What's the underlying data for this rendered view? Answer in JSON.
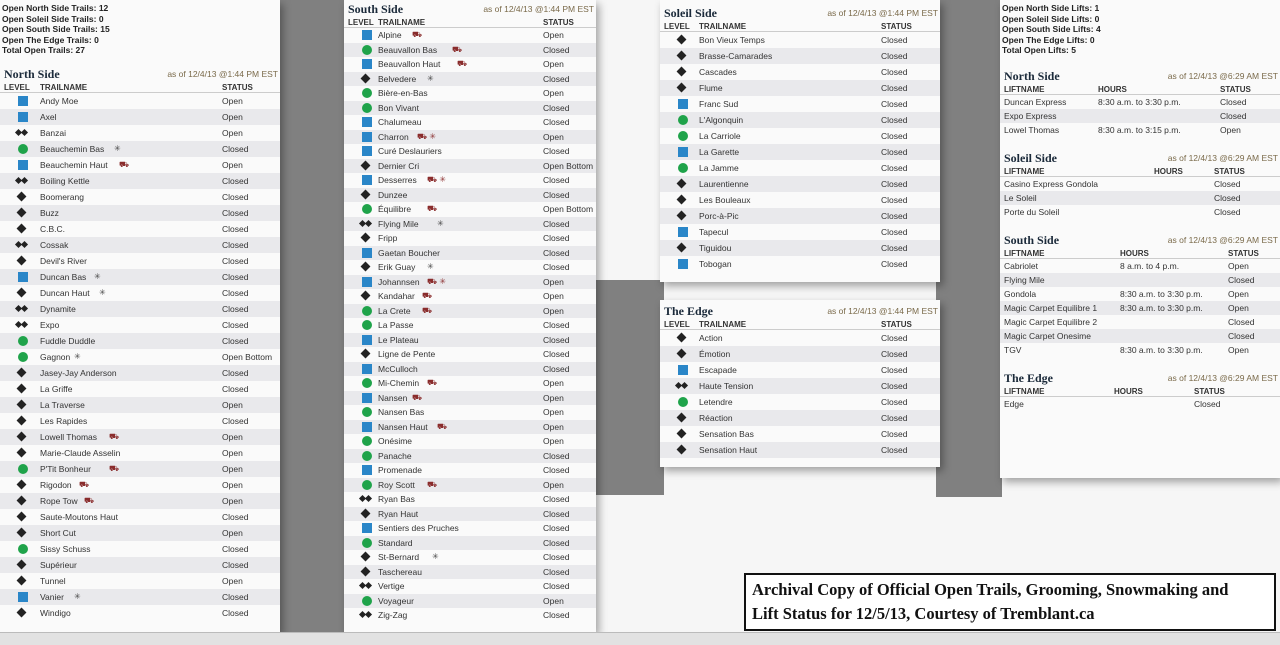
{
  "trail_summary": [
    "Open North Side Trails: 12",
    "Open Soleil Side Trails: 0",
    "Open South Side Trails: 15",
    "Open The Edge Trails: 0",
    "Total Open Trails: 27"
  ],
  "lift_summary": [
    "Open North Side Lifts: 1",
    "Open Soleil Side Lifts: 0",
    "Open South Side Lifts: 4",
    "Open The Edge Lifts: 0",
    "Total Open Lifts: 5"
  ],
  "trail_cols": {
    "level": "LEVEL",
    "name": "TRAILNAME",
    "status": "STATUS"
  },
  "lift_cols": {
    "name": "LIFTNAME",
    "hours": "HOURS",
    "status": "STATUS"
  },
  "north": {
    "title": "North Side",
    "asof": "as of 12/4/13 @1:44 PM EST",
    "trails": [
      {
        "l": "square",
        "n": "Andy Moe",
        "m": "",
        "s": "Open"
      },
      {
        "l": "square",
        "n": "Axel",
        "m": "",
        "s": "Open"
      },
      {
        "l": "double",
        "n": "Banzai",
        "m": "",
        "s": "Open"
      },
      {
        "l": "circle",
        "n": "Beauchemin Bas",
        "m": "✳",
        "s": "Closed"
      },
      {
        "l": "square",
        "n": "Beauchemin Haut",
        "m": "⛟",
        "s": "Open"
      },
      {
        "l": "double",
        "n": "Boiling Kettle",
        "m": "",
        "s": "Closed"
      },
      {
        "l": "diamond",
        "n": "Boomerang",
        "m": "",
        "s": "Closed"
      },
      {
        "l": "diamond",
        "n": "Buzz",
        "m": "",
        "s": "Closed"
      },
      {
        "l": "diamond",
        "n": "C.B.C.",
        "m": "",
        "s": "Closed"
      },
      {
        "l": "double",
        "n": "Cossak",
        "m": "",
        "s": "Closed"
      },
      {
        "l": "diamond",
        "n": "Devil's River",
        "m": "",
        "s": "Closed"
      },
      {
        "l": "square",
        "n": "Duncan Bas",
        "m": "✳",
        "s": "Closed"
      },
      {
        "l": "diamond",
        "n": "Duncan Haut",
        "m": "✳",
        "s": "Closed"
      },
      {
        "l": "double",
        "n": "Dynamite",
        "m": "",
        "s": "Closed"
      },
      {
        "l": "double",
        "n": "Expo",
        "m": "",
        "s": "Closed"
      },
      {
        "l": "circle",
        "n": "Fuddle Duddle",
        "m": "",
        "s": "Closed"
      },
      {
        "l": "circle",
        "n": "Gagnon",
        "m": "✳",
        "s": "Open Bottom"
      },
      {
        "l": "diamond",
        "n": "Jasey-Jay Anderson",
        "m": "",
        "s": "Closed"
      },
      {
        "l": "diamond",
        "n": "La Griffe",
        "m": "",
        "s": "Closed"
      },
      {
        "l": "diamond",
        "n": "La Traverse",
        "m": "",
        "s": "Open"
      },
      {
        "l": "diamond",
        "n": "Les Rapides",
        "m": "",
        "s": "Closed"
      },
      {
        "l": "diamond",
        "n": "Lowell Thomas",
        "m": "⛟",
        "s": "Open"
      },
      {
        "l": "diamond",
        "n": "Marie-Claude Asselin",
        "m": "",
        "s": "Open"
      },
      {
        "l": "circle",
        "n": "P'Tit Bonheur",
        "m": "⛟",
        "s": "Open"
      },
      {
        "l": "diamond",
        "n": "Rigodon",
        "m": "⛟",
        "s": "Open"
      },
      {
        "l": "diamond",
        "n": "Rope Tow",
        "m": "⛟",
        "s": "Open"
      },
      {
        "l": "diamond",
        "n": "Saute-Moutons Haut",
        "m": "",
        "s": "Closed"
      },
      {
        "l": "diamond",
        "n": "Short Cut",
        "m": "",
        "s": "Open"
      },
      {
        "l": "circle",
        "n": "Sissy Schuss",
        "m": "",
        "s": "Closed"
      },
      {
        "l": "diamond",
        "n": "Supérieur",
        "m": "",
        "s": "Closed"
      },
      {
        "l": "diamond",
        "n": "Tunnel",
        "m": "",
        "s": "Open"
      },
      {
        "l": "square",
        "n": "Vanier",
        "m": "✳",
        "s": "Closed"
      },
      {
        "l": "diamond",
        "n": "Windigo",
        "m": "",
        "s": "Closed"
      }
    ]
  },
  "south": {
    "title": "South Side",
    "asof": "as of 12/4/13 @1:44 PM EST",
    "trails": [
      {
        "l": "square",
        "n": "Alpine",
        "m": "⛟",
        "s": "Open"
      },
      {
        "l": "circle",
        "n": "Beauvallon Bas",
        "m": "⛟",
        "s": "Closed"
      },
      {
        "l": "square",
        "n": "Beauvallon Haut",
        "m": "⛟",
        "s": "Open"
      },
      {
        "l": "diamond",
        "n": "Belvedere",
        "m": "✳",
        "s": "Closed"
      },
      {
        "l": "circle",
        "n": "Bière-en-Bas",
        "m": "",
        "s": "Open"
      },
      {
        "l": "circle",
        "n": "Bon Vivant",
        "m": "",
        "s": "Closed"
      },
      {
        "l": "square",
        "n": "Chalumeau",
        "m": "",
        "s": "Closed"
      },
      {
        "l": "square",
        "n": "Charron",
        "m": "⛟ ✳",
        "s": "Open"
      },
      {
        "l": "square",
        "n": "Curé Deslauriers",
        "m": "",
        "s": "Closed"
      },
      {
        "l": "diamond",
        "n": "Dernier Cri",
        "m": "",
        "s": "Open Bottom"
      },
      {
        "l": "square",
        "n": "Desserres",
        "m": "⛟ ✳",
        "s": "Closed"
      },
      {
        "l": "diamond",
        "n": "Dunzee",
        "m": "",
        "s": "Closed"
      },
      {
        "l": "circle",
        "n": "Équilibre",
        "m": "⛟",
        "s": "Open Bottom"
      },
      {
        "l": "double",
        "n": "Flying Mile",
        "m": "✳",
        "s": "Closed"
      },
      {
        "l": "diamond",
        "n": "Fripp",
        "m": "",
        "s": "Closed"
      },
      {
        "l": "square",
        "n": "Gaetan Boucher",
        "m": "",
        "s": "Closed"
      },
      {
        "l": "diamond",
        "n": "Erik Guay",
        "m": "✳",
        "s": "Closed"
      },
      {
        "l": "square",
        "n": "Johannsen",
        "m": "⛟ ✳",
        "s": "Open"
      },
      {
        "l": "diamond",
        "n": "Kandahar",
        "m": "⛟",
        "s": "Open"
      },
      {
        "l": "circle",
        "n": "La Crete",
        "m": "⛟",
        "s": "Open"
      },
      {
        "l": "circle",
        "n": "La Passe",
        "m": "",
        "s": "Closed"
      },
      {
        "l": "square",
        "n": "Le Plateau",
        "m": "",
        "s": "Closed"
      },
      {
        "l": "diamond",
        "n": "Ligne de Pente",
        "m": "",
        "s": "Closed"
      },
      {
        "l": "square",
        "n": "McCulloch",
        "m": "",
        "s": "Closed"
      },
      {
        "l": "circle",
        "n": "Mi-Chemin",
        "m": "⛟",
        "s": "Open"
      },
      {
        "l": "square",
        "n": "Nansen",
        "m": "⛟",
        "s": "Open"
      },
      {
        "l": "circle",
        "n": "Nansen Bas",
        "m": "",
        "s": "Open"
      },
      {
        "l": "square",
        "n": "Nansen Haut",
        "m": "⛟",
        "s": "Open"
      },
      {
        "l": "circle",
        "n": "Onésime",
        "m": "",
        "s": "Open"
      },
      {
        "l": "circle",
        "n": "Panache",
        "m": "",
        "s": "Closed"
      },
      {
        "l": "square",
        "n": "Promenade",
        "m": "",
        "s": "Closed"
      },
      {
        "l": "circle",
        "n": "Roy Scott",
        "m": "⛟",
        "s": "Open"
      },
      {
        "l": "double",
        "n": "Ryan Bas",
        "m": "",
        "s": "Closed"
      },
      {
        "l": "diamond",
        "n": "Ryan Haut",
        "m": "",
        "s": "Closed"
      },
      {
        "l": "square",
        "n": "Sentiers des Pruches",
        "m": "",
        "s": "Closed"
      },
      {
        "l": "circle",
        "n": "Standard",
        "m": "",
        "s": "Closed"
      },
      {
        "l": "diamond",
        "n": "St-Bernard",
        "m": "✳",
        "s": "Closed"
      },
      {
        "l": "diamond",
        "n": "Taschereau",
        "m": "",
        "s": "Closed"
      },
      {
        "l": "double",
        "n": "Vertige",
        "m": "",
        "s": "Closed"
      },
      {
        "l": "circle",
        "n": "Voyageur",
        "m": "",
        "s": "Open"
      },
      {
        "l": "double",
        "n": "Zig-Zag",
        "m": "",
        "s": "Closed"
      }
    ]
  },
  "soleil": {
    "title": "Soleil Side",
    "asof": "as of 12/4/13 @1:44 PM EST",
    "trails": [
      {
        "l": "diamond",
        "n": "Bon Vieux Temps",
        "m": "",
        "s": "Closed"
      },
      {
        "l": "diamond",
        "n": "Brasse-Camarades",
        "m": "",
        "s": "Closed"
      },
      {
        "l": "diamond",
        "n": "Cascades",
        "m": "",
        "s": "Closed"
      },
      {
        "l": "diamond",
        "n": "Flume",
        "m": "",
        "s": "Closed"
      },
      {
        "l": "square",
        "n": "Franc Sud",
        "m": "",
        "s": "Closed"
      },
      {
        "l": "circle",
        "n": "L'Algonquin",
        "m": "",
        "s": "Closed"
      },
      {
        "l": "circle",
        "n": "La Carriole",
        "m": "",
        "s": "Closed"
      },
      {
        "l": "square",
        "n": "La Garette",
        "m": "",
        "s": "Closed"
      },
      {
        "l": "circle",
        "n": "La Jamme",
        "m": "",
        "s": "Closed"
      },
      {
        "l": "diamond",
        "n": "Laurentienne",
        "m": "",
        "s": "Closed"
      },
      {
        "l": "diamond",
        "n": "Les Bouleaux",
        "m": "",
        "s": "Closed"
      },
      {
        "l": "diamond",
        "n": "Porc-à-Pic",
        "m": "",
        "s": "Closed"
      },
      {
        "l": "square",
        "n": "Tapecul",
        "m": "",
        "s": "Closed"
      },
      {
        "l": "diamond",
        "n": "Tiguidou",
        "m": "",
        "s": "Closed"
      },
      {
        "l": "square",
        "n": "Tobogan",
        "m": "",
        "s": "Closed"
      }
    ]
  },
  "edge": {
    "title": "The Edge",
    "asof": "as of 12/4/13 @1:44 PM EST",
    "trails": [
      {
        "l": "diamond",
        "n": "Action",
        "m": "",
        "s": "Closed"
      },
      {
        "l": "diamond",
        "n": "Émotion",
        "m": "",
        "s": "Closed"
      },
      {
        "l": "square",
        "n": "Escapade",
        "m": "",
        "s": "Closed"
      },
      {
        "l": "double",
        "n": "Haute Tension",
        "m": "",
        "s": "Closed"
      },
      {
        "l": "circle",
        "n": "Letendre",
        "m": "",
        "s": "Closed"
      },
      {
        "l": "diamond",
        "n": "Réaction",
        "m": "",
        "s": "Closed"
      },
      {
        "l": "diamond",
        "n": "Sensation Bas",
        "m": "",
        "s": "Closed"
      },
      {
        "l": "diamond",
        "n": "Sensation Haut",
        "m": "",
        "s": "Closed"
      }
    ]
  },
  "lifts": [
    {
      "title": "North Side",
      "asof": "as of 12/4/13 @6:29 AM EST",
      "rows": [
        [
          "Duncan Express",
          "8:30 a.m. to 3:30 p.m.",
          "Closed"
        ],
        [
          "Expo Express",
          "",
          "Closed"
        ],
        [
          "Lowel Thomas",
          "8:30 a.m. to 3:15 p.m.",
          "Open"
        ]
      ]
    },
    {
      "title": "Soleil Side",
      "asof": "as of 12/4/13 @6:29 AM EST",
      "rows": [
        [
          "Casino Express Gondola",
          "",
          "Closed"
        ],
        [
          "Le Soleil",
          "",
          "Closed"
        ],
        [
          "Porte du Soleil",
          "",
          "Closed"
        ]
      ]
    },
    {
      "title": "South Side",
      "asof": "as of 12/4/13 @6:29 AM EST",
      "rows": [
        [
          "Cabriolet",
          "8 a.m. to 4 p.m.",
          "Open"
        ],
        [
          "Flying Mile",
          "",
          "Closed"
        ],
        [
          "Gondola",
          "8:30 a.m. to 3:30 p.m.",
          "Open"
        ],
        [
          "Magic Carpet Equilibre 1",
          "8:30 a.m. to 3:30 p.m.",
          "Open"
        ],
        [
          "Magic Carpet Equilibre 2",
          "",
          "Closed"
        ],
        [
          "Magic Carpet Onesime",
          "",
          "Closed"
        ],
        [
          "TGV",
          "8:30 a.m. to 3:30 p.m.",
          "Open"
        ]
      ]
    },
    {
      "title": "The Edge",
      "asof": "as of 12/4/13 @6:29 AM EST",
      "rows": [
        [
          "Edge",
          "",
          "Closed"
        ]
      ]
    }
  ],
  "caption": {
    "line1": "Archival Copy of Official Open Trails, Grooming, Snowmaking and",
    "line2": "Lift Status for 12/5/13, Courtesy of Tremblant.ca"
  }
}
